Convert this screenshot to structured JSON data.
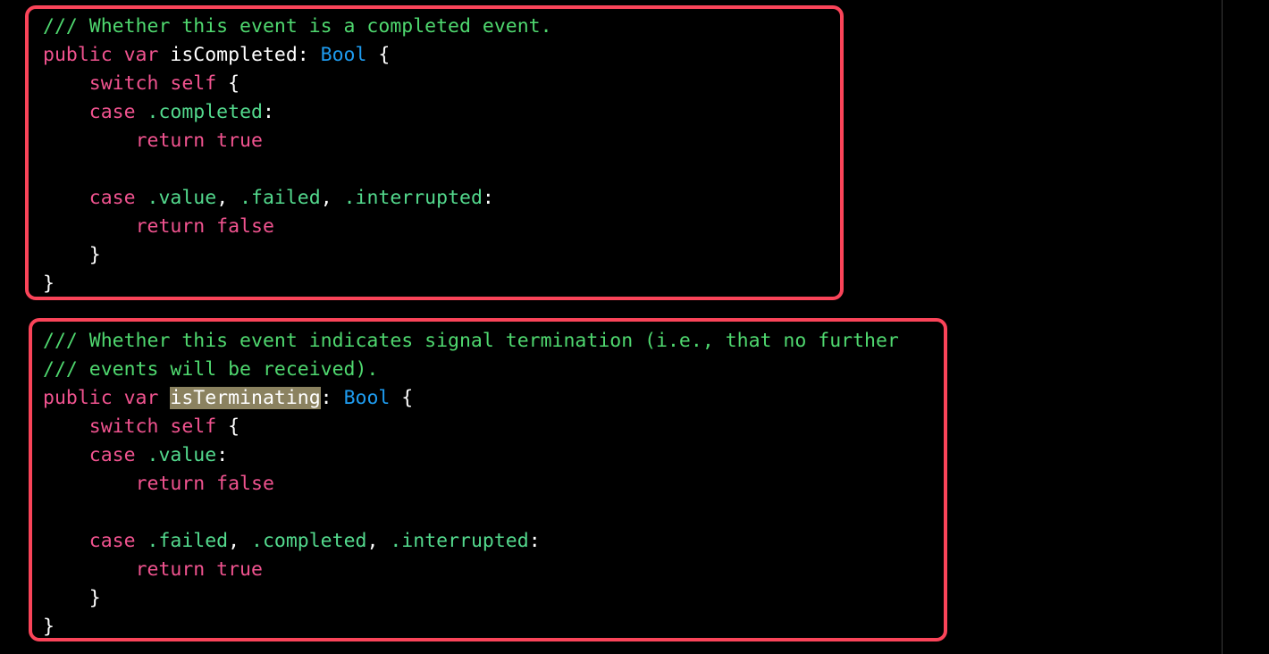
{
  "app": {
    "kind": "code-editor",
    "language": "Swift",
    "background_color": "#000000",
    "gutter_line_color": "#3a3a3a"
  },
  "theme": {
    "comment_color": "#4fd86f",
    "keyword_color": "#f0538f",
    "type_color": "#1e9cf0",
    "enum_case_color": "#53d98d",
    "plain_color": "#ffffff",
    "selection_background": "#8b8260",
    "annotation_box_color": "#fa4459"
  },
  "annotations": [
    {
      "name": "isCompleted-highlight-box",
      "color": "#fa4459"
    },
    {
      "name": "isTerminating-highlight-box",
      "color": "#fa4459"
    }
  ],
  "selection": {
    "text": "isTerminating",
    "background": "#8b8260"
  },
  "code": {
    "block_1": {
      "lines": [
        [
          {
            "t": "/// Whether this event is a completed event.",
            "c": "cmt"
          }
        ],
        [
          {
            "t": "public var ",
            "c": "kw"
          },
          {
            "t": "isCompleted",
            "c": "plain"
          },
          {
            "t": ": ",
            "c": "punc"
          },
          {
            "t": "Bool",
            "c": "type"
          },
          {
            "t": " {",
            "c": "punc"
          }
        ],
        [
          {
            "t": "    ",
            "c": "plain"
          },
          {
            "t": "switch self",
            "c": "kw"
          },
          {
            "t": " {",
            "c": "punc"
          }
        ],
        [
          {
            "t": "    ",
            "c": "plain"
          },
          {
            "t": "case",
            "c": "kw"
          },
          {
            "t": " ",
            "c": "plain"
          },
          {
            "t": ".completed",
            "c": "enm"
          },
          {
            "t": ":",
            "c": "punc"
          }
        ],
        [
          {
            "t": "        ",
            "c": "plain"
          },
          {
            "t": "return true",
            "c": "kw"
          }
        ],
        [
          {
            "t": "",
            "c": "plain"
          }
        ],
        [
          {
            "t": "    ",
            "c": "plain"
          },
          {
            "t": "case",
            "c": "kw"
          },
          {
            "t": " ",
            "c": "plain"
          },
          {
            "t": ".value",
            "c": "enm"
          },
          {
            "t": ", ",
            "c": "punc"
          },
          {
            "t": ".failed",
            "c": "enm"
          },
          {
            "t": ", ",
            "c": "punc"
          },
          {
            "t": ".interrupted",
            "c": "enm"
          },
          {
            "t": ":",
            "c": "punc"
          }
        ],
        [
          {
            "t": "        ",
            "c": "plain"
          },
          {
            "t": "return false",
            "c": "kw"
          }
        ],
        [
          {
            "t": "    }",
            "c": "punc"
          }
        ],
        [
          {
            "t": "}",
            "c": "punc"
          }
        ]
      ]
    },
    "block_2": {
      "lines": [
        [
          {
            "t": "/// Whether this event indicates signal termination (i.e., that no further",
            "c": "cmt"
          }
        ],
        [
          {
            "t": "/// events will be received).",
            "c": "cmt"
          }
        ],
        [
          {
            "t": "public var ",
            "c": "kw"
          },
          {
            "t": "isTerminating",
            "c": "plain sel"
          },
          {
            "t": ": ",
            "c": "punc"
          },
          {
            "t": "Bool",
            "c": "type"
          },
          {
            "t": " {",
            "c": "punc"
          }
        ],
        [
          {
            "t": "    ",
            "c": "plain"
          },
          {
            "t": "switch self",
            "c": "kw"
          },
          {
            "t": " {",
            "c": "punc"
          }
        ],
        [
          {
            "t": "    ",
            "c": "plain"
          },
          {
            "t": "case",
            "c": "kw"
          },
          {
            "t": " ",
            "c": "plain"
          },
          {
            "t": ".value",
            "c": "enm"
          },
          {
            "t": ":",
            "c": "punc"
          }
        ],
        [
          {
            "t": "        ",
            "c": "plain"
          },
          {
            "t": "return false",
            "c": "kw"
          }
        ],
        [
          {
            "t": "",
            "c": "plain"
          }
        ],
        [
          {
            "t": "    ",
            "c": "plain"
          },
          {
            "t": "case",
            "c": "kw"
          },
          {
            "t": " ",
            "c": "plain"
          },
          {
            "t": ".failed",
            "c": "enm"
          },
          {
            "t": ", ",
            "c": "punc"
          },
          {
            "t": ".completed",
            "c": "enm"
          },
          {
            "t": ", ",
            "c": "punc"
          },
          {
            "t": ".interrupted",
            "c": "enm"
          },
          {
            "t": ":",
            "c": "punc"
          }
        ],
        [
          {
            "t": "        ",
            "c": "plain"
          },
          {
            "t": "return true",
            "c": "kw"
          }
        ],
        [
          {
            "t": "    }",
            "c": "punc"
          }
        ],
        [
          {
            "t": "}",
            "c": "punc"
          }
        ]
      ]
    }
  }
}
